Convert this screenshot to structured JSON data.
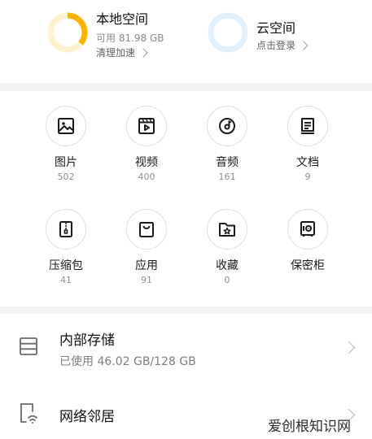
{
  "storage": {
    "local": {
      "title": "本地空间",
      "available": "可用 81.98 GB",
      "action": "清理加速",
      "used_fraction": 0.36,
      "ring_color": "#f7b500",
      "ring_track_color": "#fdf0cc"
    },
    "cloud": {
      "title": "云空间",
      "action": "点击登录",
      "ring_track_color": "#e3f1fd"
    }
  },
  "categories": [
    {
      "label": "图片",
      "count": "502",
      "icon": "image-icon"
    },
    {
      "label": "视频",
      "count": "400",
      "icon": "video-icon"
    },
    {
      "label": "音频",
      "count": "161",
      "icon": "audio-disc-icon"
    },
    {
      "label": "文档",
      "count": "9",
      "icon": "document-icon"
    },
    {
      "label": "压缩包",
      "count": "41",
      "icon": "zip-archive-icon"
    },
    {
      "label": "应用",
      "count": "91",
      "icon": "app-bag-icon"
    },
    {
      "label": "收藏",
      "count": "0",
      "icon": "favorite-folder-icon"
    },
    {
      "label": "保密柜",
      "count": "",
      "icon": "safe-box-icon"
    }
  ],
  "internal_storage": {
    "title": "内部存储",
    "usage": "已使用 46.02 GB/128 GB",
    "icon": "storage-list-icon"
  },
  "network_neighbor": {
    "title": "网络邻居",
    "icon": "network-device-icon"
  },
  "watermark": "爱创根知识网"
}
